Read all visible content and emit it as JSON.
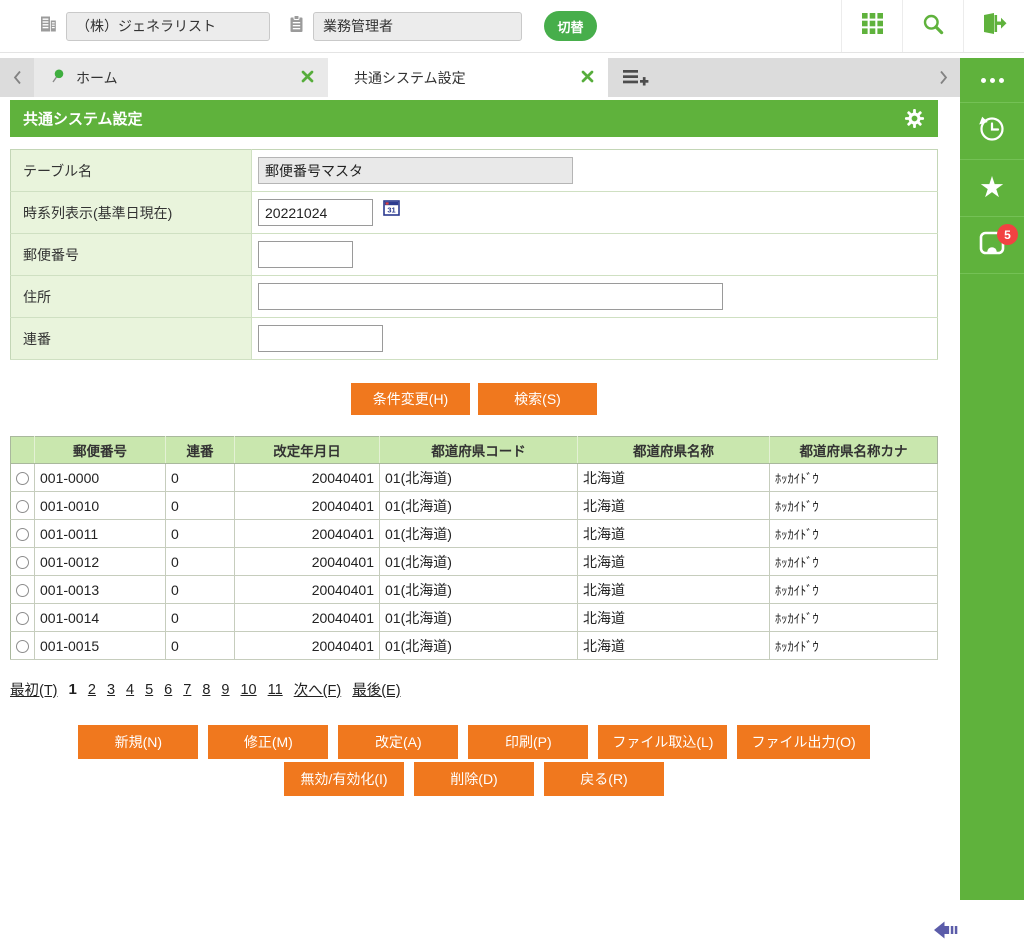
{
  "colors": {
    "brand_green": "#5fb23c",
    "form_label_green": "#e9f4dc",
    "table_header_green": "#c9e7ae",
    "button_orange": "#f0781e",
    "badge_red": "#f24242",
    "collapse_arrow_blue": "#5b5ca9"
  },
  "topbar": {
    "company": {
      "value": "（株）ジェネラリスト"
    },
    "role": {
      "value": "業務管理者"
    },
    "switch_button": "切替"
  },
  "tabbar": {
    "home_tab": "ホーム",
    "active_tab": "共通システム設定"
  },
  "page": {
    "title": "共通システム設定"
  },
  "form": {
    "rows": [
      {
        "label": "テーブル名",
        "value": "郵便番号マスタ"
      },
      {
        "label": "時系列表示(基準日現在)",
        "value": "20221024"
      },
      {
        "label": "郵便番号",
        "value": ""
      },
      {
        "label": "住所",
        "value": ""
      },
      {
        "label": "連番",
        "value": ""
      }
    ]
  },
  "search": {
    "condition_button": "条件変更(H)",
    "search_button": "検索(S)"
  },
  "table": {
    "headers": [
      "郵便番号",
      "連番",
      "改定年月日",
      "都道府県コード",
      "都道府県名称",
      "都道府県名称カナ"
    ],
    "rows": [
      [
        "001-0000",
        "0",
        "20040401",
        "01(北海道)",
        "北海道",
        "ﾎｯｶｲﾄﾞｳ"
      ],
      [
        "001-0010",
        "0",
        "20040401",
        "01(北海道)",
        "北海道",
        "ﾎｯｶｲﾄﾞｳ"
      ],
      [
        "001-0011",
        "0",
        "20040401",
        "01(北海道)",
        "北海道",
        "ﾎｯｶｲﾄﾞｳ"
      ],
      [
        "001-0012",
        "0",
        "20040401",
        "01(北海道)",
        "北海道",
        "ﾎｯｶｲﾄﾞｳ"
      ],
      [
        "001-0013",
        "0",
        "20040401",
        "01(北海道)",
        "北海道",
        "ﾎｯｶｲﾄﾞｳ"
      ],
      [
        "001-0014",
        "0",
        "20040401",
        "01(北海道)",
        "北海道",
        "ﾎｯｶｲﾄﾞｳ"
      ],
      [
        "001-0015",
        "0",
        "20040401",
        "01(北海道)",
        "北海道",
        "ﾎｯｶｲﾄﾞｳ"
      ]
    ]
  },
  "pagination": {
    "first": "最初(T)",
    "current": "1",
    "pages": [
      "2",
      "3",
      "4",
      "5",
      "6",
      "7",
      "8",
      "9",
      "10",
      "11"
    ],
    "next": "次へ(F)",
    "last": "最後(E)"
  },
  "actions": {
    "row1": [
      "新規(N)",
      "修正(M)",
      "改定(A)",
      "印刷(P)",
      "ファイル取込(L)",
      "ファイル出力(O)"
    ],
    "row2": [
      "無効/有効化(I)",
      "削除(D)",
      "戻る(R)"
    ]
  },
  "sidebar": {
    "notification_count": "5"
  }
}
